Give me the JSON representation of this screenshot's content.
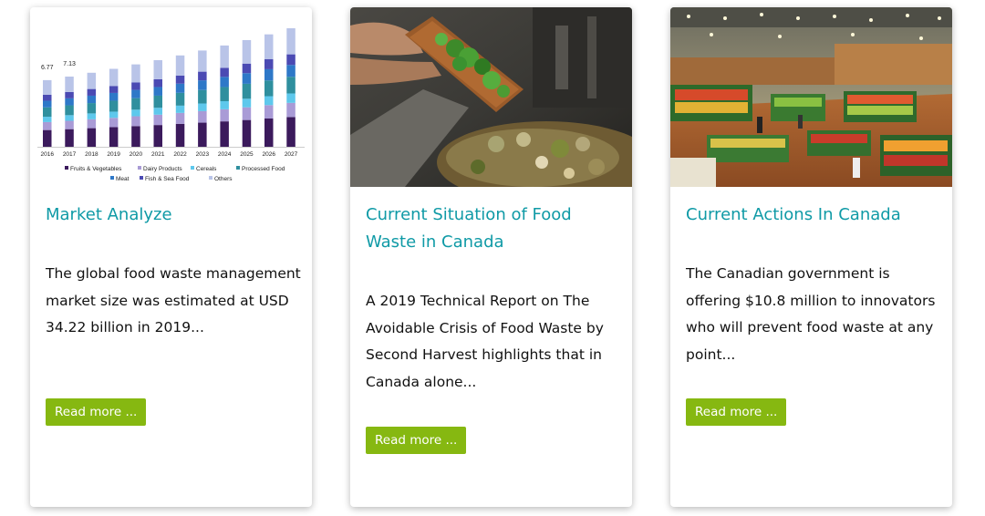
{
  "cards": [
    {
      "title": "Market Analyze",
      "text": "The global food waste management market size was estimated at USD 34.22 billion in 2019...",
      "button": "Read more ..."
    },
    {
      "title": "Current Situation of Food Waste in Canada",
      "text": "A 2019 Technical Report on The Avoidable Crisis of Food Waste by Second Harvest highlights that in Canada alone...",
      "button": "Read more ..."
    },
    {
      "title": "Current Actions In Canada",
      "text": "The Canadian government is offering $10.8 million to innovators who will prevent food waste at any point...",
      "button": "Read more ..."
    }
  ],
  "chart_data": {
    "type": "bar",
    "stacked": true,
    "title": "",
    "xlabel": "",
    "ylabel": "",
    "categories": [
      "2016",
      "2017",
      "2018",
      "2019",
      "2020",
      "2021",
      "2022",
      "2023",
      "2024",
      "2025",
      "2026",
      "2027"
    ],
    "data_labels": [
      "6.77",
      "7.13",
      "",
      "",
      "",
      "",
      "",
      "",
      "",
      "",
      "",
      ""
    ],
    "legend_position": "bottom",
    "series": [
      {
        "name": "Fruits & Vegetables",
        "color": "#3b1a5c",
        "values": [
          1.7,
          1.79,
          1.89,
          1.99,
          2.1,
          2.21,
          2.33,
          2.45,
          2.58,
          2.72,
          2.87,
          3.02
        ]
      },
      {
        "name": "Dairy Products",
        "color": "#a99bd6",
        "values": [
          0.81,
          0.85,
          0.9,
          0.95,
          1.0,
          1.05,
          1.11,
          1.17,
          1.23,
          1.29,
          1.36,
          1.44
        ]
      },
      {
        "name": "Cereals",
        "color": "#5ec8ec",
        "values": [
          0.54,
          0.57,
          0.6,
          0.63,
          0.67,
          0.7,
          0.74,
          0.78,
          0.82,
          0.87,
          0.91,
          0.96
        ]
      },
      {
        "name": "Processed Food",
        "color": "#2f8f9e",
        "values": [
          0.95,
          1.0,
          1.05,
          1.11,
          1.17,
          1.23,
          1.3,
          1.37,
          1.44,
          1.52,
          1.6,
          1.69
        ]
      },
      {
        "name": "Meat",
        "color": "#2e78c8",
        "values": [
          0.68,
          0.71,
          0.75,
          0.79,
          0.84,
          0.88,
          0.93,
          0.98,
          1.03,
          1.08,
          1.14,
          1.2
        ]
      },
      {
        "name": "Fish & Sea Food",
        "color": "#4b4ab3",
        "values": [
          0.61,
          0.64,
          0.68,
          0.71,
          0.75,
          0.79,
          0.83,
          0.88,
          0.92,
          0.97,
          1.03,
          1.08
        ]
      },
      {
        "name": "Others",
        "color": "#b9c4e8",
        "values": [
          1.48,
          1.57,
          1.65,
          1.74,
          1.84,
          1.94,
          2.04,
          2.15,
          2.27,
          2.39,
          2.51,
          2.65
        ]
      }
    ]
  }
}
